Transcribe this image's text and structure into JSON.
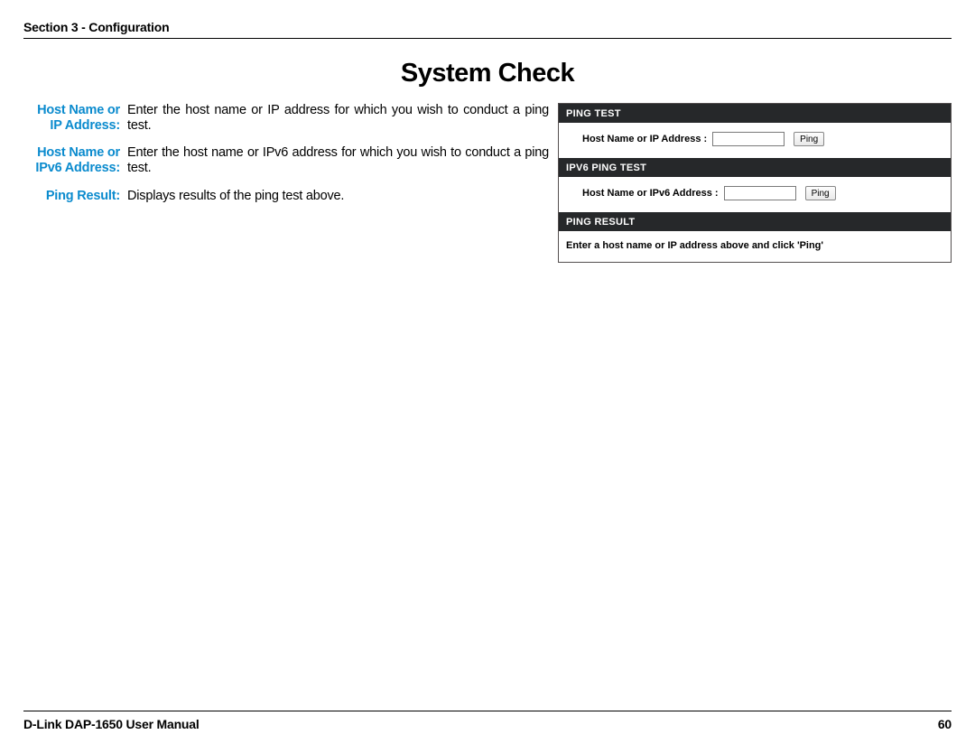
{
  "header": {
    "section": "Section 3 - Configuration"
  },
  "title": "System Check",
  "definitions": [
    {
      "label": "Host Name or IP Address:",
      "desc": "Enter the host name or IP address for which you wish to conduct a ping test."
    },
    {
      "label": "Host Name or IPv6 Address:",
      "desc": "Enter the host name or IPv6 address for which you wish to conduct a ping test."
    },
    {
      "label": "Ping Result:",
      "desc": "Displays results of the ping test above."
    }
  ],
  "panel": {
    "ping_test": {
      "header": "PING TEST",
      "label": "Host Name or IP Address  :",
      "button": "Ping"
    },
    "ipv6_ping_test": {
      "header": "IPV6 PING TEST",
      "label": "Host Name or IPv6 Address  :",
      "button": "Ping"
    },
    "ping_result": {
      "header": "PING RESULT",
      "message": "Enter a host name or IP address above and click 'Ping'"
    }
  },
  "footer": {
    "left": "D-Link DAP-1650 User Manual",
    "page": "60"
  }
}
